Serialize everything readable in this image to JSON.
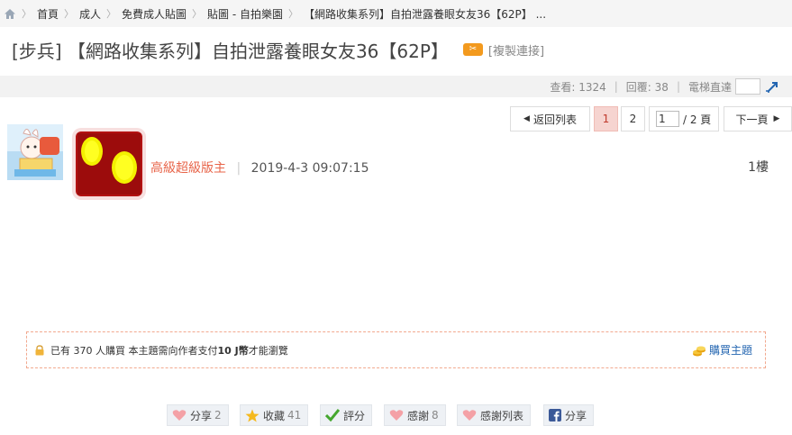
{
  "breadcrumb": {
    "items": [
      "首頁",
      "成人",
      "免費成人貼圖",
      "貼圖 - 自拍樂園",
      "【網路收集系列】自拍泄露養眼女友36【62P】 ..."
    ]
  },
  "thread": {
    "title": "[步兵] 【網路收集系列】自拍泄露養眼女友36【62P】",
    "copy_link": "[複製連接]"
  },
  "stats": {
    "views": "查看: 1324",
    "replies": "回覆: 38",
    "elevator": "電梯直達"
  },
  "pagination": {
    "back": "返回列表",
    "pages": [
      "1",
      "2"
    ],
    "current_page_input": "1",
    "total": "/ 2 頁",
    "next": "下一頁"
  },
  "post": {
    "author_rank": "高級超級版主",
    "time": "2019-4-3 09:07:15",
    "floor": "1樓"
  },
  "purchase": {
    "text": "已有 370 人購買  本主題需向作者支付 ",
    "price": "10 J幣",
    "text_after": " 才能瀏覽",
    "buy_label": "購買主題"
  },
  "actions": {
    "share": "分享",
    "share_count": "2",
    "favorite": "收藏",
    "favorite_count": "41",
    "rate": "評分",
    "thanks": "感謝",
    "thanks_count": "8",
    "thanks_list": "感謝列表",
    "fb_share": "分享"
  },
  "colors": {
    "accent_orange": "#e8654a",
    "link_blue": "#2466b1",
    "current_page_bg": "#f6d4d0",
    "facebook_blue": "#3b5998"
  }
}
